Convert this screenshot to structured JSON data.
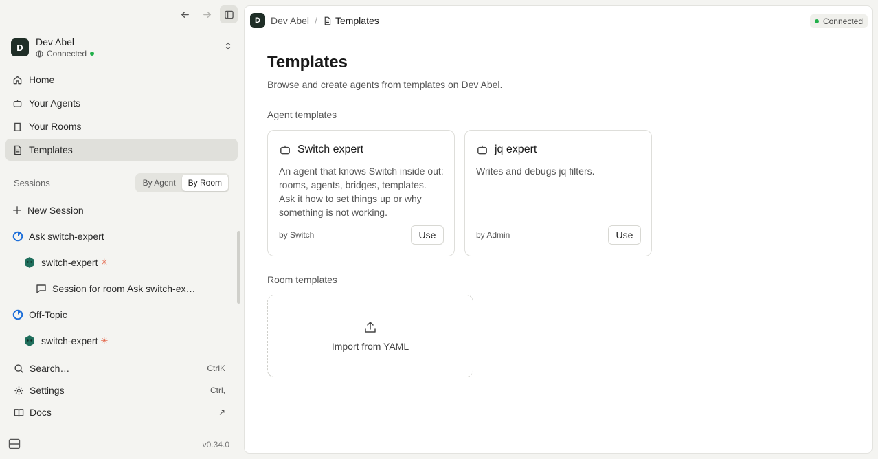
{
  "workspace": {
    "avatar": "D",
    "name": "Dev Abel",
    "status": "Connected"
  },
  "nav": [
    {
      "label": "Home",
      "icon": "home-icon"
    },
    {
      "label": "Your Agents",
      "icon": "bot-icon"
    },
    {
      "label": "Your Rooms",
      "icon": "door-icon"
    },
    {
      "label": "Templates",
      "icon": "file-icon",
      "active": true
    }
  ],
  "sessions": {
    "label": "Sessions",
    "toggle": [
      "By Agent",
      "By Room"
    ],
    "active_toggle": "By Room",
    "new_session": "New Session",
    "tree": [
      {
        "level": 0,
        "label": "Ask switch-expert",
        "icon": "room-icon"
      },
      {
        "level": 1,
        "label": "switch-expert",
        "icon": "agent-avatar-icon",
        "spark": "✳"
      },
      {
        "level": 2,
        "label": "Session for room Ask switch-expert",
        "icon": "chat-bubble-icon"
      },
      {
        "level": 0,
        "label": "Off-Topic",
        "icon": "room-icon"
      },
      {
        "level": 1,
        "label": "switch-expert",
        "icon": "agent-avatar-icon",
        "spark": "✳"
      }
    ]
  },
  "bottom": {
    "search": {
      "label": "Search…",
      "shortcut": "CtrlK"
    },
    "settings": {
      "label": "Settings",
      "shortcut": "Ctrl,"
    },
    "docs": {
      "label": "Docs",
      "shortcut": "↗"
    },
    "version": "v0.34.0"
  },
  "breadcrumb": {
    "avatar": "D",
    "workspace": "Dev Abel",
    "separator": "/",
    "page": "Templates"
  },
  "connection_badge": "Connected",
  "page": {
    "title": "Templates",
    "description": "Browse and create agents from templates on Dev Abel.",
    "agent_templates_label": "Agent templates",
    "room_templates_label": "Room templates",
    "agent_templates": [
      {
        "title": "Switch expert",
        "description": "An agent that knows Switch inside out: rooms, agents, bridges, templates. Ask it how to set things up or why something is not working.",
        "author": "by Switch",
        "action": "Use"
      },
      {
        "title": "jq expert",
        "description": "Writes and debugs jq filters.",
        "author": "by Admin",
        "action": "Use"
      }
    ],
    "import_label": "Import from YAML"
  },
  "colors": {
    "accent_dark": "#1f2e27",
    "status_green": "#22b04b",
    "spark": "#e2593b",
    "room_blue": "#1e6fd9"
  }
}
